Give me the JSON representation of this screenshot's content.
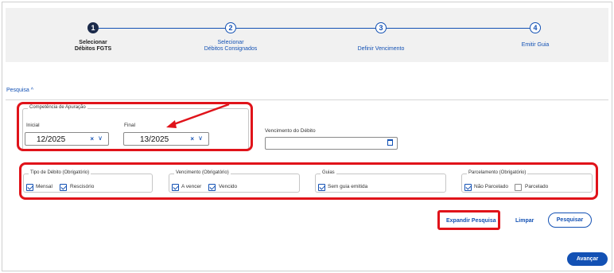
{
  "stepper": {
    "steps": [
      {
        "number": "1",
        "label_line1": "Selecionar",
        "label_line2": "Débitos FGTS",
        "state": "active"
      },
      {
        "number": "2",
        "label_line1": "Selecionar",
        "label_line2": "Débitos Consignados",
        "state": "inactive"
      },
      {
        "number": "3",
        "label_line1": "Definir Vencimento",
        "label_line2": "",
        "state": "inactive"
      },
      {
        "number": "4",
        "label_line1": "Emitir Guia",
        "label_line2": "",
        "state": "inactive"
      }
    ]
  },
  "search": {
    "toggle_label": "Pesquisa ^"
  },
  "competencia": {
    "legend": "Competência de Apuração",
    "inicial_label": "Inicial",
    "inicial_value": "12/2025",
    "final_label": "Final",
    "final_value": "13/2025",
    "clear_glyph": "×",
    "chevron_glyph": "∨"
  },
  "vencimento_debito": {
    "label": "Vencimento do Débito",
    "value": ""
  },
  "filters": {
    "tipo": {
      "legend": "Tipo de Débito (Obrigatório)",
      "options": [
        {
          "label": "Mensal",
          "checked": true
        },
        {
          "label": "Rescisório",
          "checked": true
        }
      ]
    },
    "vencimento": {
      "legend": "Vencimento (Obrigatório)",
      "options": [
        {
          "label": "A vencer",
          "checked": true
        },
        {
          "label": "Vencido",
          "checked": true
        }
      ]
    },
    "guias": {
      "legend": "Guias",
      "options": [
        {
          "label": "Sem guia emitida",
          "checked": true
        }
      ]
    },
    "parcelamento": {
      "legend": "Parcelamento (Obrigatório)",
      "options": [
        {
          "label": "Não Parcelado",
          "checked": true
        },
        {
          "label": "Parcelado",
          "checked": false
        }
      ]
    }
  },
  "actions": {
    "expand_label": "Expandir Pesquisa",
    "clear_label": "Limpar",
    "search_label": "Pesquisar",
    "next_label": "Avançar"
  },
  "colors": {
    "accent": "#1351b4",
    "annotation_red": "#e0131a",
    "stepper_bg": "#f1f1f1"
  }
}
